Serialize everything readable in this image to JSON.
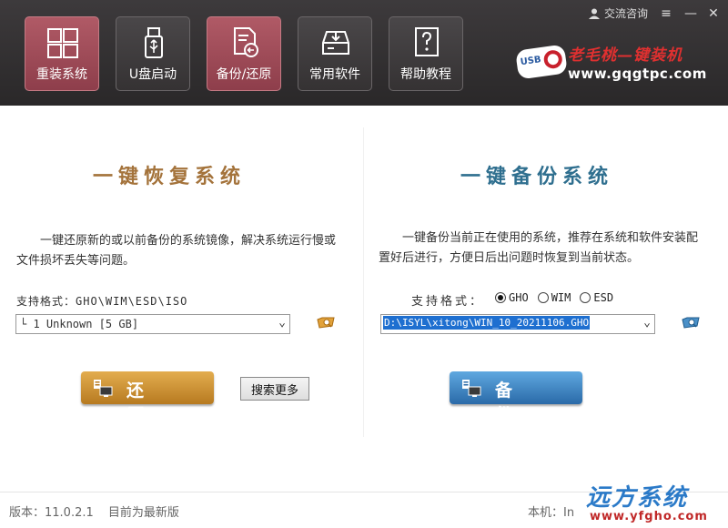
{
  "header": {
    "consult_label": "交流咨询",
    "tabs": [
      {
        "label": "重装系统",
        "icon": "windows-icon",
        "active": true
      },
      {
        "label": "U盘启动",
        "icon": "usb-drive-icon",
        "active": false
      },
      {
        "label": "备份/还原",
        "icon": "backup-restore-icon",
        "active": false
      },
      {
        "label": "常用软件",
        "icon": "software-box-icon",
        "active": false
      },
      {
        "label": "帮助教程",
        "icon": "help-document-icon",
        "active": false
      }
    ],
    "logo": {
      "badge_text": "USB",
      "title": "老毛桃—键装机",
      "url": "www.gqgtpc.com"
    }
  },
  "restore_panel": {
    "title": "一键恢复系统",
    "description": "一键还原新的或以前备份的系统镜像，解决系统运行慢或文件损坏丢失等问题。",
    "format_label": "支持格式：GHO\\WIM\\ESD\\ISO",
    "image_select_value": "└ 1 Unknown [5 GB]",
    "action_label": "还原",
    "search_more_label": "搜索更多"
  },
  "backup_panel": {
    "title": "一键备份系统",
    "description": "一键备份当前正在使用的系统，推荐在系统和软件安装配置好后进行，方便日后出问题时恢复到当前状态。",
    "format_label": "支持格式：",
    "formats": [
      {
        "label": "GHO",
        "selected": true
      },
      {
        "label": "WIM",
        "selected": false
      },
      {
        "label": "ESD",
        "selected": false
      }
    ],
    "path_value": "D:\\ISYL\\xitong\\WIN_10_20211106.GHO",
    "action_label": "备份"
  },
  "footer": {
    "version": "版本：11.0.2.1",
    "update_status": "目前为最新版",
    "local_label": "本机：In"
  },
  "watermark": {
    "title": "远方系统",
    "url": "www.yfgho.com"
  },
  "colors": {
    "header_bg": "#353233",
    "active_tab": "#9e4a57",
    "restore_accent": "#a4733b",
    "backup_accent": "#2f6f8f"
  }
}
